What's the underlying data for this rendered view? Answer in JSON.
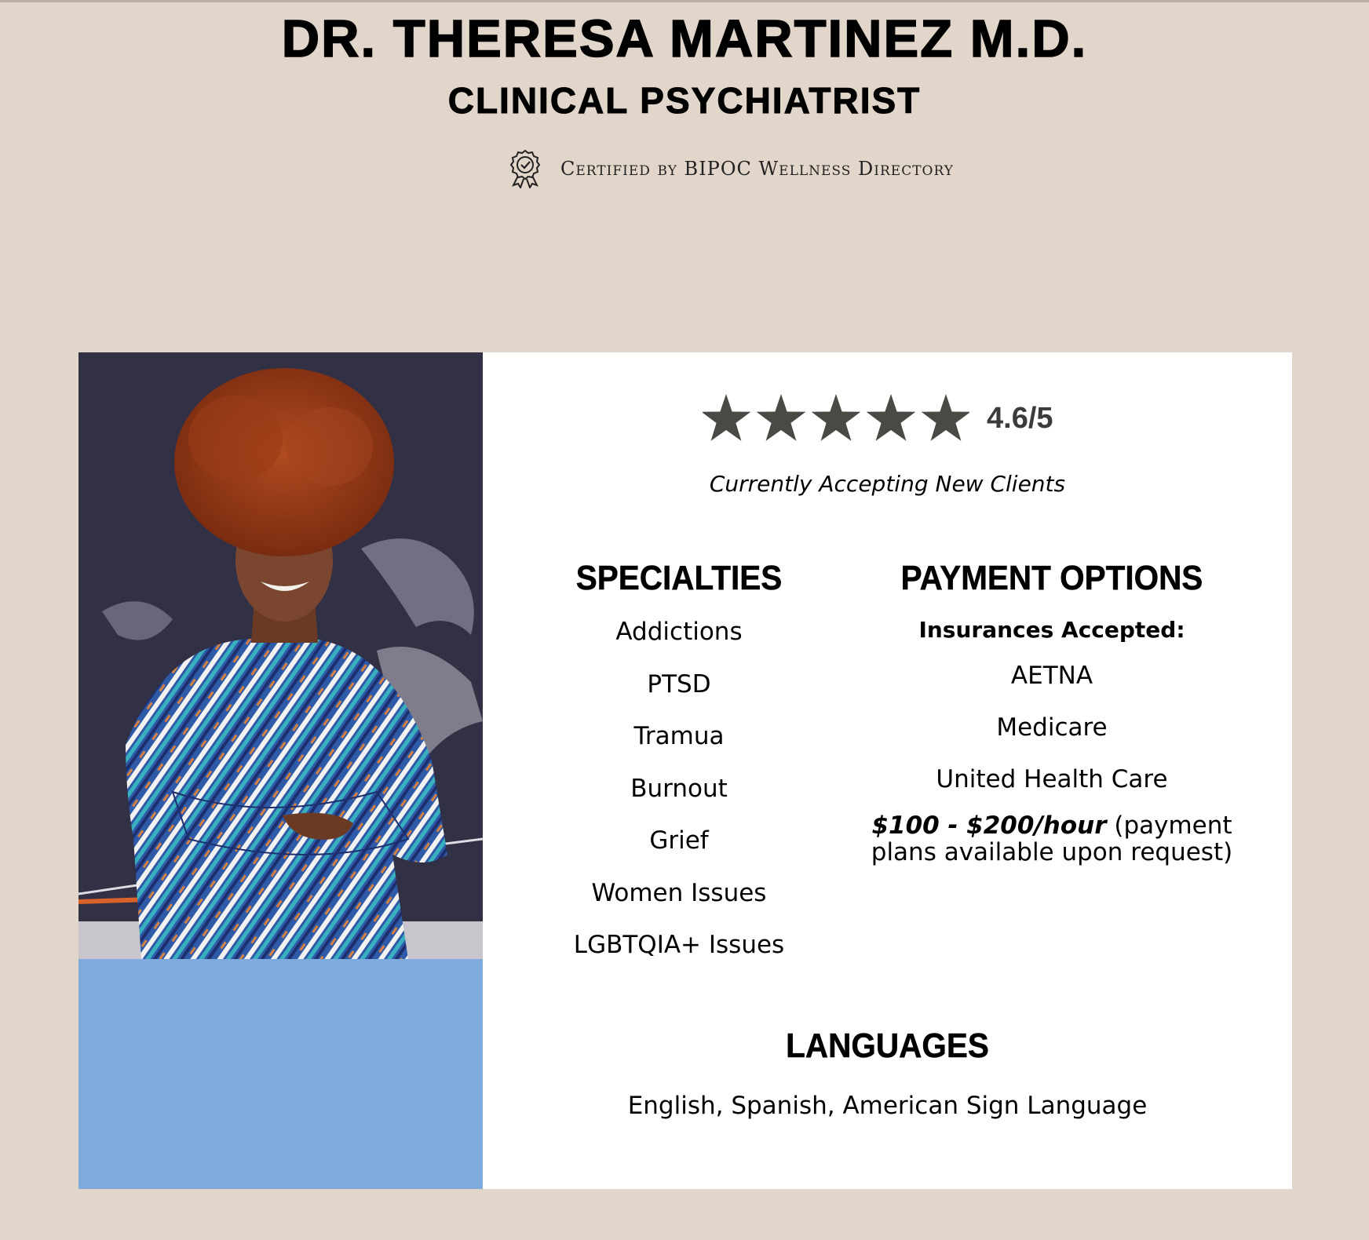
{
  "header": {
    "name": "DR. THERESA MARTINEZ M.D.",
    "title": "CLINICAL PSYCHIATRIST",
    "certified": "Certified by BIPOC Wellness Directory",
    "certified_icon": "award-badge-icon"
  },
  "rating": {
    "value": 4.6,
    "max": 5,
    "text": "4.6/5",
    "star_color": "#4a4a44",
    "star_empty_color": "#9a9a96"
  },
  "status": "Currently Accepting New Clients",
  "specialties": {
    "heading": "SPECIALTIES",
    "items": [
      "Addictions",
      "PTSD",
      "Tramua",
      "Burnout",
      "Grief",
      "Women Issues",
      "LGBTQIA+ Issues"
    ]
  },
  "payment": {
    "heading": "PAYMENT OPTIONS",
    "insurances_label": "Insurances Accepted:",
    "insurances": [
      "AETNA",
      "Medicare",
      "United Health Care"
    ],
    "price_range": "$100 - $200/hour",
    "price_note": " (payment plans available upon request)"
  },
  "languages": {
    "heading": "LANGUAGES",
    "list": "English, Spanish, American Sign Language"
  },
  "colors": {
    "background": "#e2d6ca",
    "card": "#ffffff",
    "accent_block": "#7eaadd"
  }
}
